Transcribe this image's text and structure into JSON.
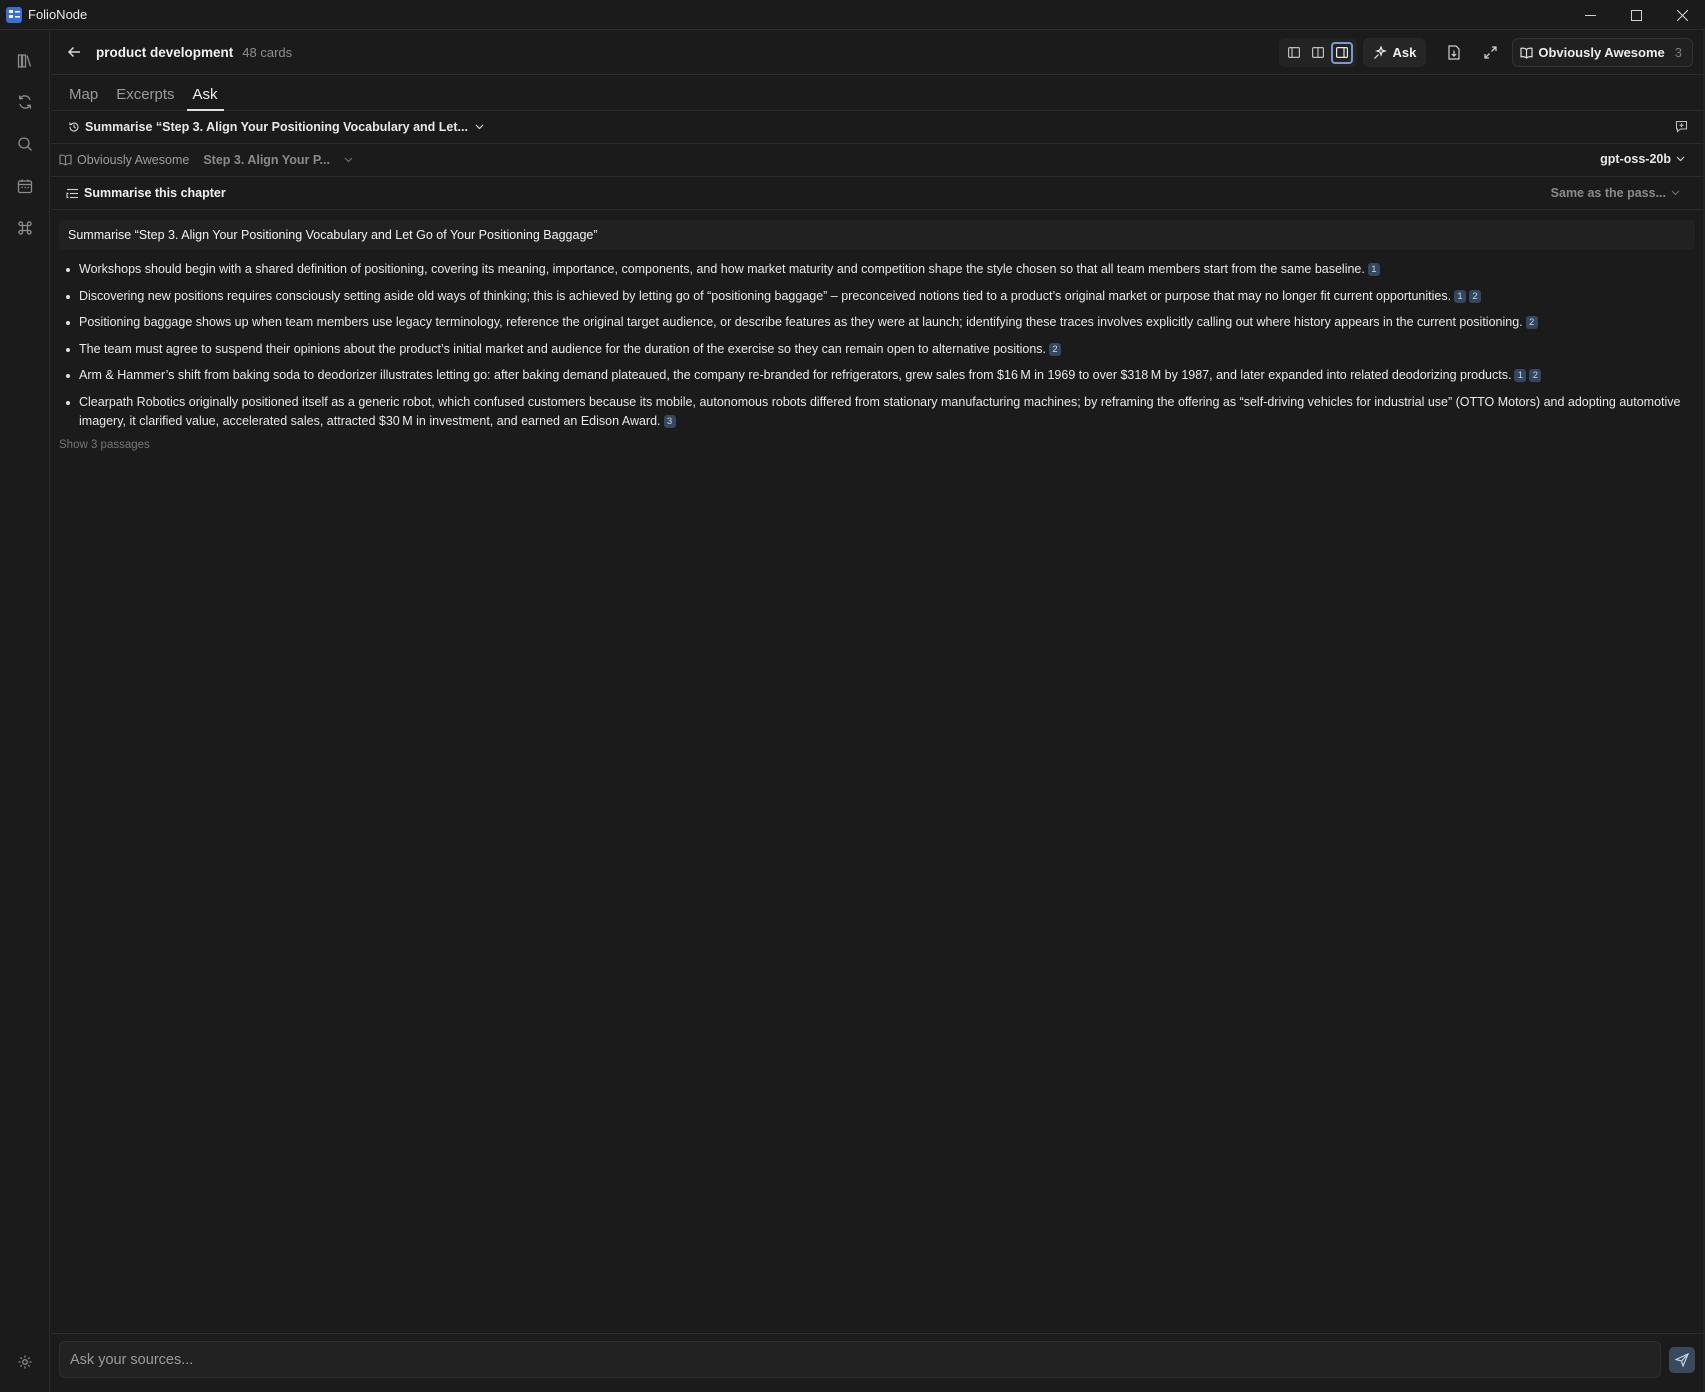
{
  "window": {
    "title": "FolioNode",
    "controls": [
      "minimize-icon",
      "maximize-icon",
      "close-icon"
    ]
  },
  "rail": {
    "items": [
      "library-icon",
      "sync-icon",
      "search-icon",
      "calendar-icon",
      "command-icon"
    ],
    "bottom": "settings-icon"
  },
  "header": {
    "title": "product development",
    "count": "48 cards",
    "ask_label": "Ask",
    "book_label": "Obviously Awesome",
    "book_count": "3"
  },
  "tabs": [
    {
      "label": "Map",
      "active": false
    },
    {
      "label": "Excerpts",
      "active": false
    },
    {
      "label": "Ask",
      "active": true
    }
  ],
  "history": {
    "label": "Summarise “Step 3. Align Your Positioning Vocabulary and Let..."
  },
  "source": {
    "book": "Obviously Awesome",
    "chapter": "Step 3. Align Your P...",
    "model": "gpt-oss-20b"
  },
  "action": {
    "label": "Summarise this chapter",
    "scope": "Same as the pass..."
  },
  "question": "Summarise “Step 3. Align Your Positioning Vocabulary and Let Go of Your Positioning Baggage”",
  "answer": [
    {
      "text": "Workshops should begin with a shared definition of positioning, covering its meaning, importance, components, and how market maturity and competition shape the style chosen so that all team members start from the same baseline.",
      "cites": [
        "1"
      ]
    },
    {
      "text": "Discovering new positions requires consciously setting aside old ways of thinking; this is achieved by letting go of “positioning baggage” – preconceived notions tied to a product’s original market or purpose that may no longer fit current opportunities.",
      "cites": [
        "1",
        "2"
      ]
    },
    {
      "text": "Positioning baggage shows up when team members use legacy terminology, reference the original target audience, or describe features as they were at launch; identifying these traces involves explicitly calling out where history appears in the current positioning.",
      "cites": [
        "2"
      ]
    },
    {
      "text": "The team must agree to suspend their opinions about the product’s initial market and audience for the duration of the exercise so they can remain open to alternative positions.",
      "cites": [
        "2"
      ]
    },
    {
      "text": "Arm & Hammer’s shift from baking soda to deodorizer illustrates letting go: after baking demand plateaued, the company re-branded for refrigerators, grew sales from $16 M in 1969 to over $318 M by 1987, and later expanded into related deodorizing products.",
      "cites": [
        "1",
        "2"
      ]
    },
    {
      "text": "Clearpath Robotics originally positioned itself as a generic robot, which confused customers because its mobile, autonomous robots differed from stationary manufacturing machines; by reframing the offering as “self-driving vehicles for industrial use” (OTTO Motors) and adopting automotive imagery, it clarified value, accelerated sales, attracted $30 M in investment, and earned an Edison Award.",
      "cites": [
        "3"
      ]
    }
  ],
  "show_passages": "Show 3 passages",
  "composer": {
    "placeholder": "Ask your sources..."
  }
}
